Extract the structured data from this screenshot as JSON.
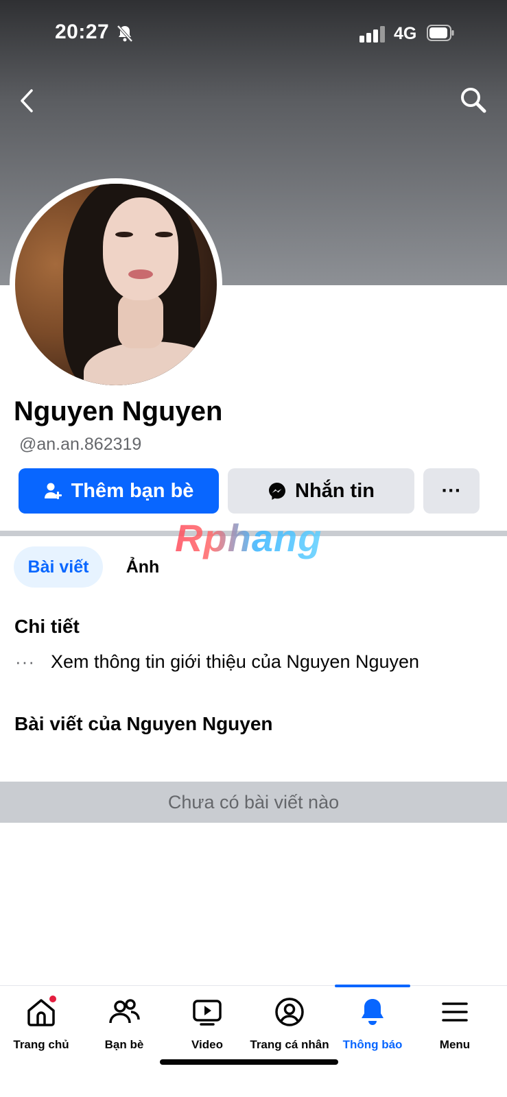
{
  "status_bar": {
    "time": "20:27",
    "network": "4G"
  },
  "profile": {
    "name": "Nguyen Nguyen",
    "handle": "@an.an.862319"
  },
  "actions": {
    "add_friend": "Thêm bạn bè",
    "message": "Nhắn tin",
    "more": "···"
  },
  "watermark": "Rphang",
  "tabs": [
    {
      "label": "Bài viết",
      "active": true
    },
    {
      "label": "Ảnh",
      "active": false
    }
  ],
  "details": {
    "title": "Chi tiết",
    "dots": "···",
    "intro_link": "Xem thông tin giới thiệu của Nguyen Nguyen"
  },
  "posts": {
    "title": "Bài viết của Nguyen Nguyen",
    "empty": "Chưa có bài viết nào"
  },
  "bottom_nav": [
    {
      "label": "Trang chủ",
      "icon": "home-icon",
      "badge": true
    },
    {
      "label": "Bạn bè",
      "icon": "friends-icon"
    },
    {
      "label": "Video",
      "icon": "video-icon"
    },
    {
      "label": "Trang cá nhân",
      "icon": "profile-icon"
    },
    {
      "label": "Thông báo",
      "icon": "bell-icon",
      "active": true
    },
    {
      "label": "Menu",
      "icon": "menu-icon"
    }
  ],
  "colors": {
    "accent": "#0866ff",
    "badge": "#e41e3f",
    "secondary_button": "#e4e6eb"
  }
}
